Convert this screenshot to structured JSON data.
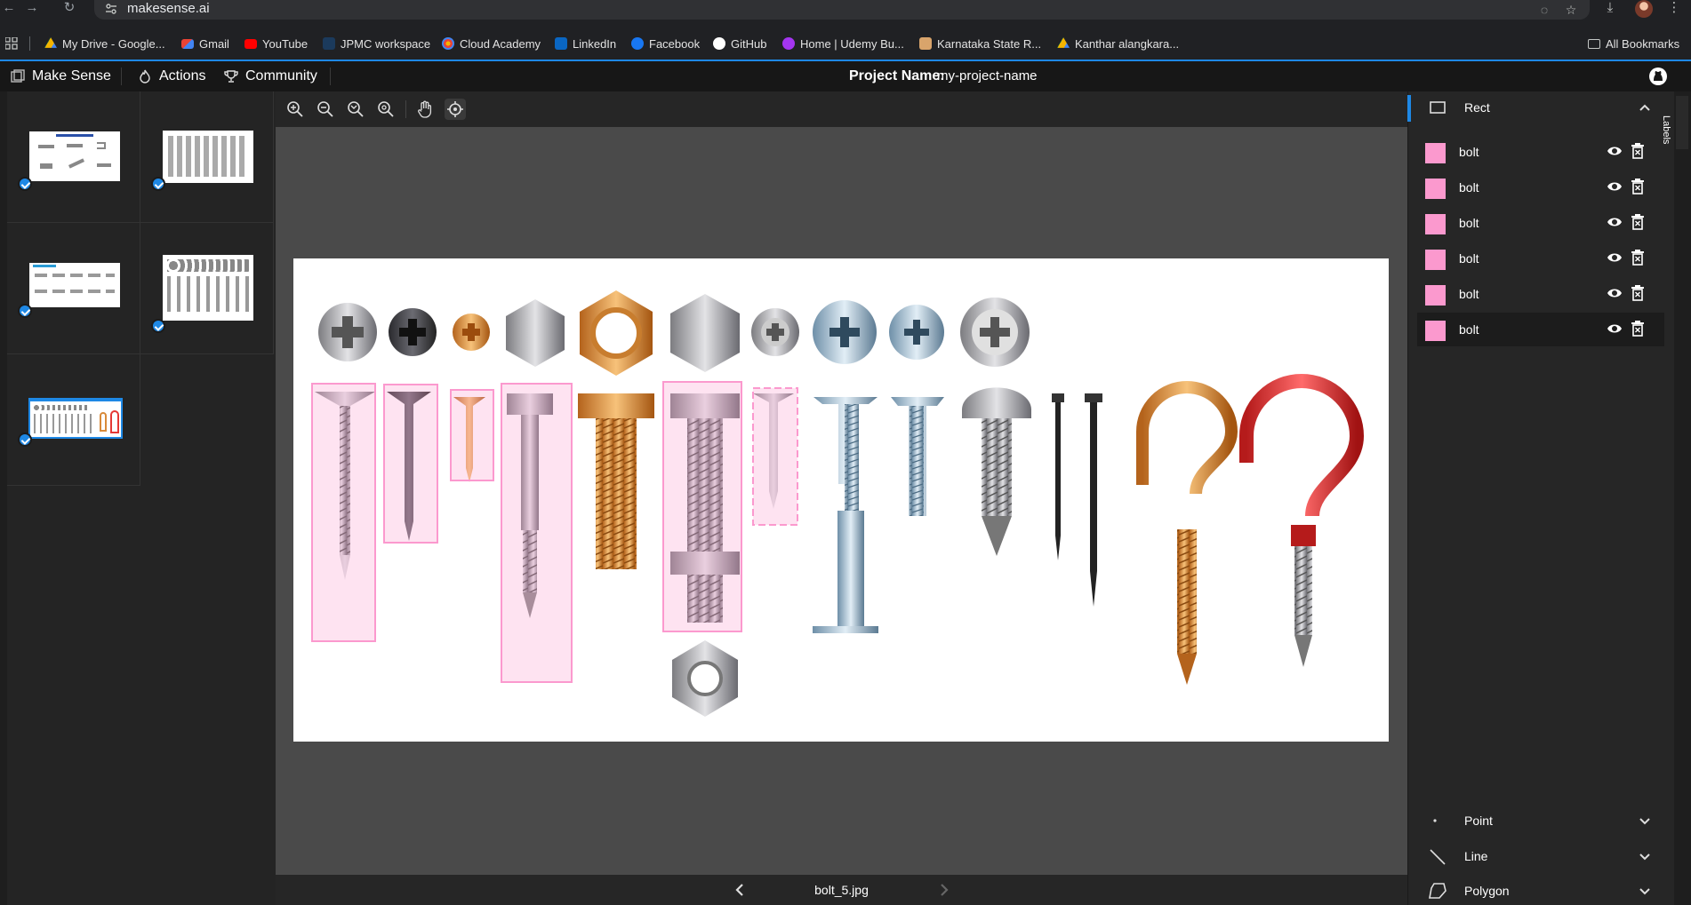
{
  "browser": {
    "url": "makesense.ai",
    "bookmarks": [
      {
        "label": "My Drive - Google...",
        "icon": "google-drive-icon"
      },
      {
        "label": "Gmail",
        "icon": "gmail-icon"
      },
      {
        "label": "YouTube",
        "icon": "youtube-icon"
      },
      {
        "label": "JPMC workspace",
        "icon": "jpmc-icon"
      },
      {
        "label": "Cloud Academy",
        "icon": "cloud-academy-icon"
      },
      {
        "label": "LinkedIn",
        "icon": "linkedin-icon"
      },
      {
        "label": "Facebook",
        "icon": "facebook-icon"
      },
      {
        "label": "GitHub",
        "icon": "github-icon"
      },
      {
        "label": "Home | Udemy Bu...",
        "icon": "udemy-icon"
      },
      {
        "label": "Karnataka State R...",
        "icon": "karnataka-icon"
      },
      {
        "label": "Kanthar alangkara...",
        "icon": "google-drive-icon"
      }
    ],
    "all_bookmarks": "All Bookmarks"
  },
  "header": {
    "brand": "Make Sense",
    "actions": "Actions",
    "community": "Community",
    "project_name_label": "Project Name:",
    "project_name_value": "my-project-name"
  },
  "thumbnails": [
    {
      "name": "types-of-bolts-1",
      "checked": true
    },
    {
      "name": "bolts-collection-2",
      "checked": true
    },
    {
      "name": "types-of-bolts-3",
      "checked": true
    },
    {
      "name": "bolts-collection-4",
      "checked": true
    },
    {
      "name": "bolt-5",
      "checked": true,
      "selected": true
    }
  ],
  "editor": {
    "image_name": "bolt_5.jpg",
    "tools": [
      "zoom-in-icon",
      "zoom-out-icon",
      "zoom-fit-icon",
      "zoom-reset-icon",
      "hand-icon",
      "crosshair-icon"
    ]
  },
  "right_panel": {
    "rect_title": "Rect",
    "labels": [
      {
        "name": "bolt",
        "color": "#fb99ce"
      },
      {
        "name": "bolt",
        "color": "#fb99ce"
      },
      {
        "name": "bolt",
        "color": "#fb99ce"
      },
      {
        "name": "bolt",
        "color": "#fb99ce"
      },
      {
        "name": "bolt",
        "color": "#fb99ce"
      },
      {
        "name": "bolt",
        "color": "#fb99ce"
      }
    ],
    "point_title": "Point",
    "line_title": "Line",
    "polygon_title": "Polygon",
    "vertical_tab": "Labels"
  },
  "colors": {
    "accent": "#1e88e5",
    "label_pink": "#fb99ce",
    "app_bg": "#171717",
    "canvas_bg": "#4a4a4a"
  }
}
